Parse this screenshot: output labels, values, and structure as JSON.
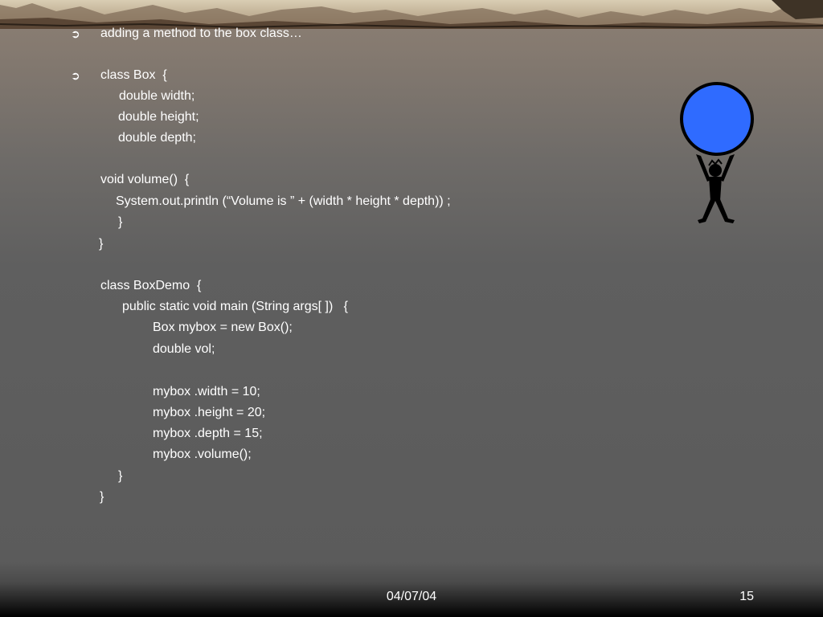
{
  "slide": {
    "bullet_glyph": "➲",
    "lines": [
      "adding a method to the box class…",
      "class Box  {",
      "double width;",
      "double height;",
      "double depth;",
      "void volume()  {",
      "System.out.println (“Volume is ” + (width * height * depth)) ;",
      "}",
      "}",
      "class BoxDemo  {",
      "public static void main (String args[ ])   {",
      "Box mybox = new Box();",
      "double vol;",
      "mybox .width = 10;",
      "mybox .height = 20;",
      "mybox .depth = 15;",
      "mybox .volume();",
      "}",
      "}"
    ]
  },
  "figure": {
    "ball_color": "#2f6bff",
    "icon": "person-holding-ball-icon"
  },
  "footer": {
    "date": "04/07/04",
    "page_number": "15"
  }
}
